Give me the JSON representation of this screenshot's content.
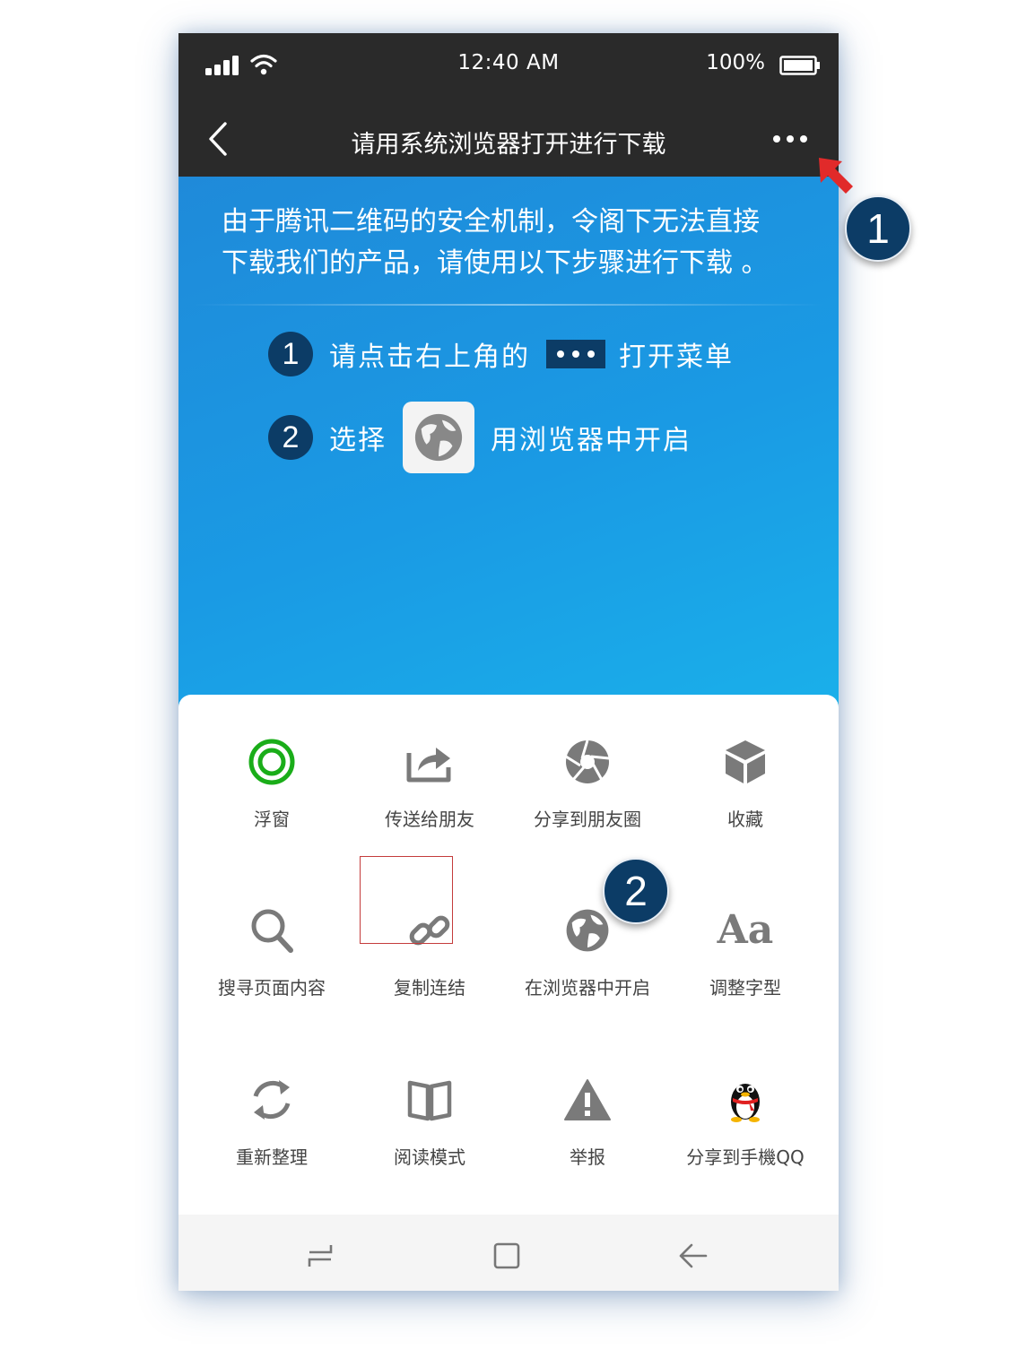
{
  "status": {
    "time": "12:40 AM",
    "battery": "100%"
  },
  "header": {
    "title": "请用系统浏览器打开进行下载"
  },
  "intro": {
    "line1": "由于腾讯二维码的安全机制，令阁下无法直接",
    "line2": "下载我们的产品，请使用以下步骤进行下载 。"
  },
  "steps": [
    {
      "num": "1",
      "text_before": "请点击右上角的",
      "text_after": "打开菜单"
    },
    {
      "num": "2",
      "text_before": "选择",
      "text_after": "用浏览器中开启"
    }
  ],
  "menu": {
    "items": [
      {
        "label": "浮窗",
        "icon": "floating-window-icon"
      },
      {
        "label": "传送给朋友",
        "icon": "share-forward-icon"
      },
      {
        "label": "分享到朋友圈",
        "icon": "moments-icon"
      },
      {
        "label": "收藏",
        "icon": "favorite-cube-icon"
      },
      {
        "label": "搜寻页面内容",
        "icon": "search-icon"
      },
      {
        "label": "复制连结",
        "icon": "link-icon"
      },
      {
        "label": "在浏览器中开启",
        "icon": "globe-icon"
      },
      {
        "label": "调整字型",
        "icon": "font-icon"
      },
      {
        "label": "重新整理",
        "icon": "refresh-icon"
      },
      {
        "label": "阅读模式",
        "icon": "book-icon"
      },
      {
        "label": "举报",
        "icon": "warning-icon"
      },
      {
        "label": "分享到手機QQ",
        "icon": "qq-penguin-icon"
      }
    ]
  },
  "font_icon_text": "Aa",
  "callouts": {
    "first": "1",
    "second": "2"
  },
  "colors": {
    "header_bg": "#2a2a2a",
    "content_gradient_start": "#1f8ad9",
    "content_gradient_end": "#1ab0ea",
    "badge": "#0c3c66",
    "highlight_border": "#c43c3c",
    "floating_icon": "#1aad19",
    "menu_icon": "#7a7a7a"
  }
}
